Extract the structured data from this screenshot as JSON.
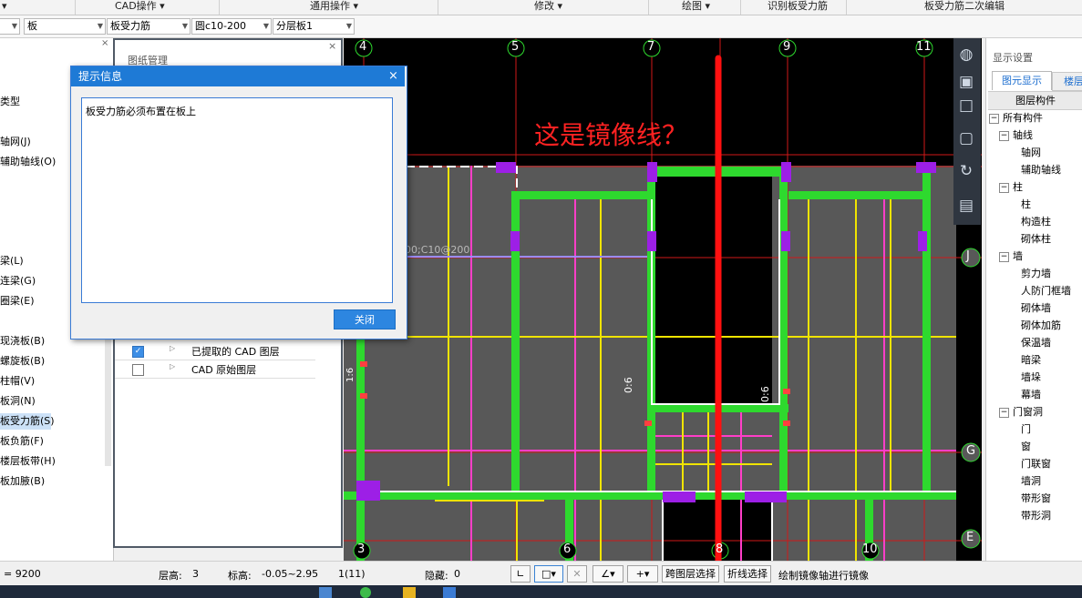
{
  "ribbon": {
    "items": [
      "CAD操作 ▾",
      "通用操作 ▾",
      "修改 ▾",
      "绘图 ▾",
      "识别板受力筋",
      "板受力筋二次编辑"
    ],
    "left_fragment": "▾"
  },
  "combobar": {
    "c0": "",
    "c1": "板",
    "c2": "板受力筋",
    "c3": "圆c10-200",
    "c4": "分层板1"
  },
  "left_panel": {
    "items": [
      "类型",
      "轴网(J)",
      "辅助轴线(O)",
      "梁(L)",
      "连梁(G)",
      "圈梁(E)",
      "现浇板(B)",
      "螺旋板(B)",
      "柱帽(V)",
      "板洞(N)",
      "板受力筋(S)",
      "板负筋(F)",
      "楼层板带(H)",
      "板加腋(B)"
    ],
    "close_x": "×"
  },
  "drawing_manager": {
    "title": "图纸管理",
    "close_x": "×",
    "layers": [
      {
        "label": "已提取的 CAD 图层",
        "checked": true
      },
      {
        "label": "CAD 原始图层",
        "checked": false
      }
    ]
  },
  "dialog": {
    "title": "提示信息",
    "message": "板受力筋必须布置在板上",
    "close_label": "关闭",
    "x_icon": "×"
  },
  "canvas": {
    "annotation": "这是镜像线？",
    "axis_labels_top": [
      "4",
      "5",
      "7",
      "9",
      "11"
    ],
    "axis_labels_bottom": [
      "3",
      "6",
      "8",
      "10"
    ],
    "axis_labels_right": [
      "J",
      "G",
      "E"
    ],
    "rebar_label": "200;C10@200",
    "dim_labels": [
      "0:6",
      "0:6",
      "1:6"
    ]
  },
  "right_panel": {
    "title": "显示设置",
    "tabs": [
      "图元显示",
      "楼层"
    ],
    "header": "图层构件",
    "tree": [
      {
        "label": "所有构件",
        "level": 0,
        "expander": "−"
      },
      {
        "label": "轴线",
        "level": 1,
        "expander": "−"
      },
      {
        "label": "轴网",
        "level": 2
      },
      {
        "label": "辅助轴线",
        "level": 2
      },
      {
        "label": "柱",
        "level": 1,
        "expander": "−"
      },
      {
        "label": "柱",
        "level": 2
      },
      {
        "label": "构造柱",
        "level": 2
      },
      {
        "label": "砌体柱",
        "level": 2
      },
      {
        "label": "墙",
        "level": 1,
        "expander": "−"
      },
      {
        "label": "剪力墙",
        "level": 2
      },
      {
        "label": "人防门框墙",
        "level": 2
      },
      {
        "label": "砌体墙",
        "level": 2
      },
      {
        "label": "砌体加筋",
        "level": 2
      },
      {
        "label": "保温墙",
        "level": 2
      },
      {
        "label": "暗梁",
        "level": 2
      },
      {
        "label": "墙垛",
        "level": 2
      },
      {
        "label": "幕墙",
        "level": 2
      },
      {
        "label": "门窗洞",
        "level": 1,
        "expander": "−"
      },
      {
        "label": "门",
        "level": 2
      },
      {
        "label": "窗",
        "level": 2
      },
      {
        "label": "门联窗",
        "level": 2
      },
      {
        "label": "墙洞",
        "level": 2
      },
      {
        "label": "带形窗",
        "level": 2
      },
      {
        "label": "带形洞",
        "level": 2
      }
    ]
  },
  "status": {
    "coord": "= 9200",
    "floor_height_label": "层高:",
    "floor_height": "3",
    "elevation_label": "标高:",
    "elevation": "-0.05~2.95",
    "count": "1(11)",
    "hidden_label": "隐藏:",
    "hidden": "0",
    "cross_layer": "跨图层选择",
    "polyline": "折线选择",
    "hint": "绘制镜像轴进行镜像"
  }
}
